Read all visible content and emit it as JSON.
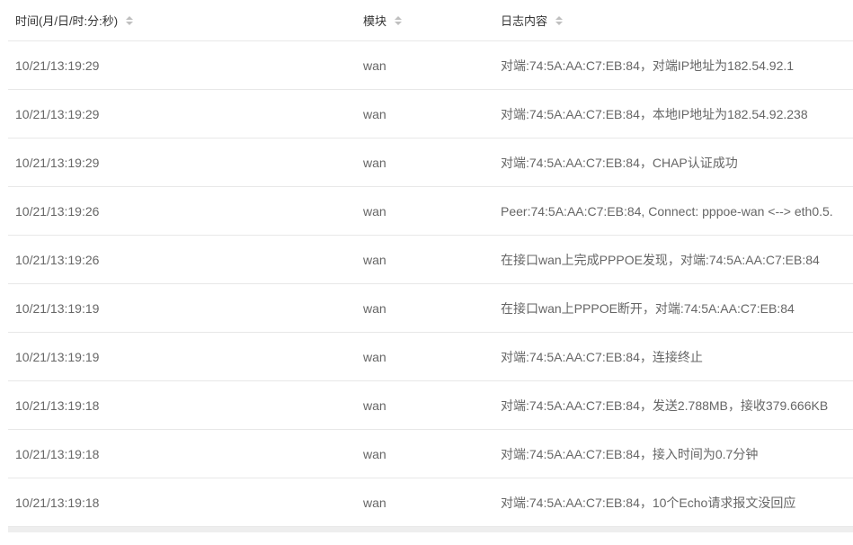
{
  "columns": {
    "time": "时间(月/日/时:分:秒)",
    "module": "模块",
    "log": "日志内容"
  },
  "rows": [
    {
      "time": "10/21/13:19:29",
      "module": "wan",
      "log": "对端:74:5A:AA:C7:EB:84，对端IP地址为182.54.92.1"
    },
    {
      "time": "10/21/13:19:29",
      "module": "wan",
      "log": "对端:74:5A:AA:C7:EB:84，本地IP地址为182.54.92.238"
    },
    {
      "time": "10/21/13:19:29",
      "module": "wan",
      "log": "对端:74:5A:AA:C7:EB:84，CHAP认证成功"
    },
    {
      "time": "10/21/13:19:26",
      "module": "wan",
      "log": "Peer:74:5A:AA:C7:EB:84, Connect: pppoe-wan <--> eth0.5."
    },
    {
      "time": "10/21/13:19:26",
      "module": "wan",
      "log": "在接口wan上完成PPPOE发现，对端:74:5A:AA:C7:EB:84"
    },
    {
      "time": "10/21/13:19:19",
      "module": "wan",
      "log": "在接口wan上PPPOE断开，对端:74:5A:AA:C7:EB:84"
    },
    {
      "time": "10/21/13:19:19",
      "module": "wan",
      "log": "对端:74:5A:AA:C7:EB:84，连接终止"
    },
    {
      "time": "10/21/13:19:18",
      "module": "wan",
      "log": "对端:74:5A:AA:C7:EB:84，发送2.788MB，接收379.666KB"
    },
    {
      "time": "10/21/13:19:18",
      "module": "wan",
      "log": "对端:74:5A:AA:C7:EB:84，接入时间为0.7分钟"
    },
    {
      "time": "10/21/13:19:18",
      "module": "wan",
      "log": "对端:74:5A:AA:C7:EB:84，10个Echo请求报文没回应"
    }
  ]
}
